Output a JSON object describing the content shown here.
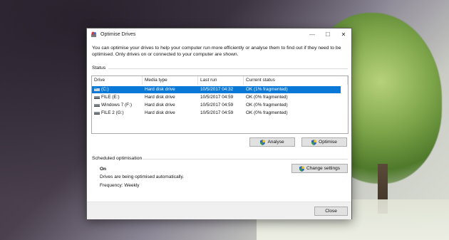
{
  "window": {
    "title": "Optimise Drives"
  },
  "description": "You can optimise your drives to help your computer run more efficiently or analyse them to find out if they need to be optimised. Only drives on or connected to your computer are shown.",
  "status": {
    "group_label": "Status",
    "columns": [
      "Drive",
      "Media type",
      "Last run",
      "Current status"
    ],
    "rows": [
      {
        "drive": "(C:)",
        "media": "Hard disk drive",
        "last_run": "10/5/2017 04:32",
        "status": "OK (1% fragmented)",
        "selected": true
      },
      {
        "drive": "FILE (E:)",
        "media": "Hard disk drive",
        "last_run": "10/5/2017 04:59",
        "status": "OK (0% fragmented)",
        "selected": false
      },
      {
        "drive": "Windows 7 (F:)",
        "media": "Hard disk drive",
        "last_run": "10/5/2017 04:59",
        "status": "OK (0% fragmented)",
        "selected": false
      },
      {
        "drive": "FILE 2 (G:)",
        "media": "Hard disk drive",
        "last_run": "10/5/2017 04:59",
        "status": "OK (0% fragmented)",
        "selected": false
      }
    ],
    "analyse_label": "Analyse",
    "optimise_label": "Optimise"
  },
  "scheduled": {
    "group_label": "Scheduled optimisation",
    "state": "On",
    "detail": "Drives are being optimised automatically.",
    "frequency": "Frequency: Weekly",
    "change_label": "Change settings"
  },
  "footer": {
    "close_label": "Close"
  },
  "colors": {
    "selection": "#0a78d7",
    "button_face": "#e1e1e1"
  }
}
